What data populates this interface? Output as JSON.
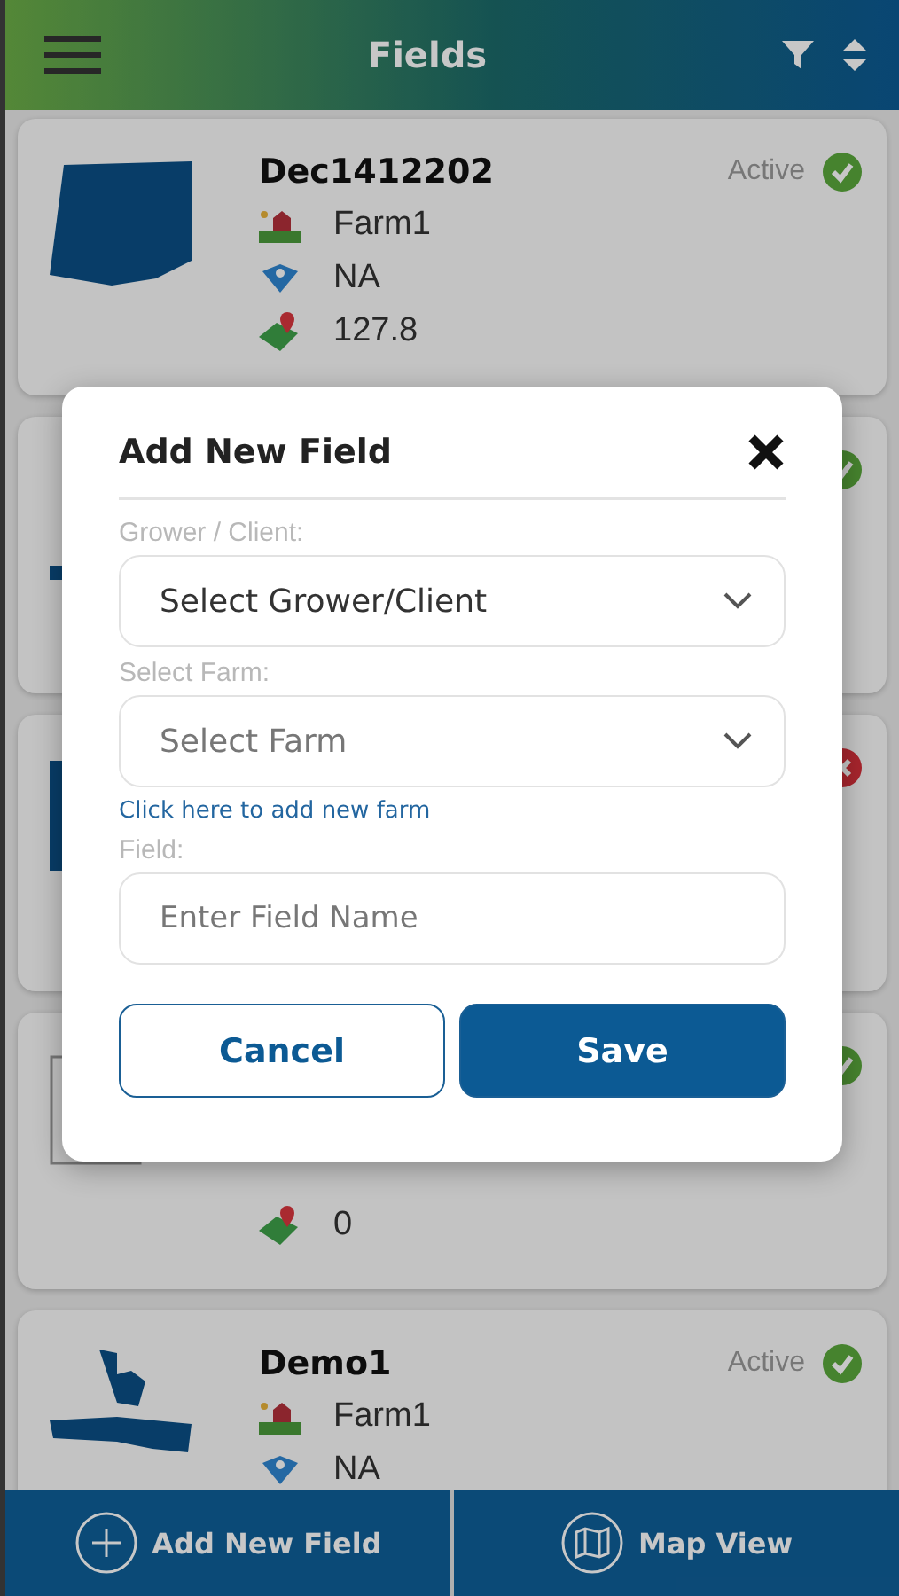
{
  "header": {
    "title": "Fields"
  },
  "cards": [
    {
      "name": "Dec1412202",
      "status": {
        "kind": "active",
        "label": "Active"
      },
      "farm": "Farm1",
      "zone": "NA",
      "area": "127.8"
    },
    {
      "status": {
        "kind": "active"
      }
    },
    {
      "status": {
        "kind": "inactive"
      }
    },
    {
      "status": {
        "kind": "active"
      },
      "area": "0"
    },
    {
      "name": "Demo1",
      "status": {
        "kind": "active",
        "label": "Active"
      },
      "farm": "Farm1",
      "zone": "NA"
    }
  ],
  "dialog": {
    "title": "Add New Field",
    "fields": [
      {
        "kind": "select",
        "label": "Grower / Client:",
        "value": "Select Grower/Client"
      },
      {
        "kind": "select",
        "label": "Select Farm:",
        "placeholder": "Select Farm",
        "link": "Click here to add new farm"
      },
      {
        "kind": "input",
        "label": "Field:",
        "placeholder": "Enter Field Name"
      }
    ],
    "buttons": [
      {
        "kind": "secondary",
        "label": "Cancel"
      },
      {
        "kind": "primary",
        "label": "Save"
      }
    ]
  },
  "bottom_bar": [
    {
      "kind": "add",
      "label": "Add New Field"
    },
    {
      "kind": "map",
      "label": "Map View"
    }
  ]
}
